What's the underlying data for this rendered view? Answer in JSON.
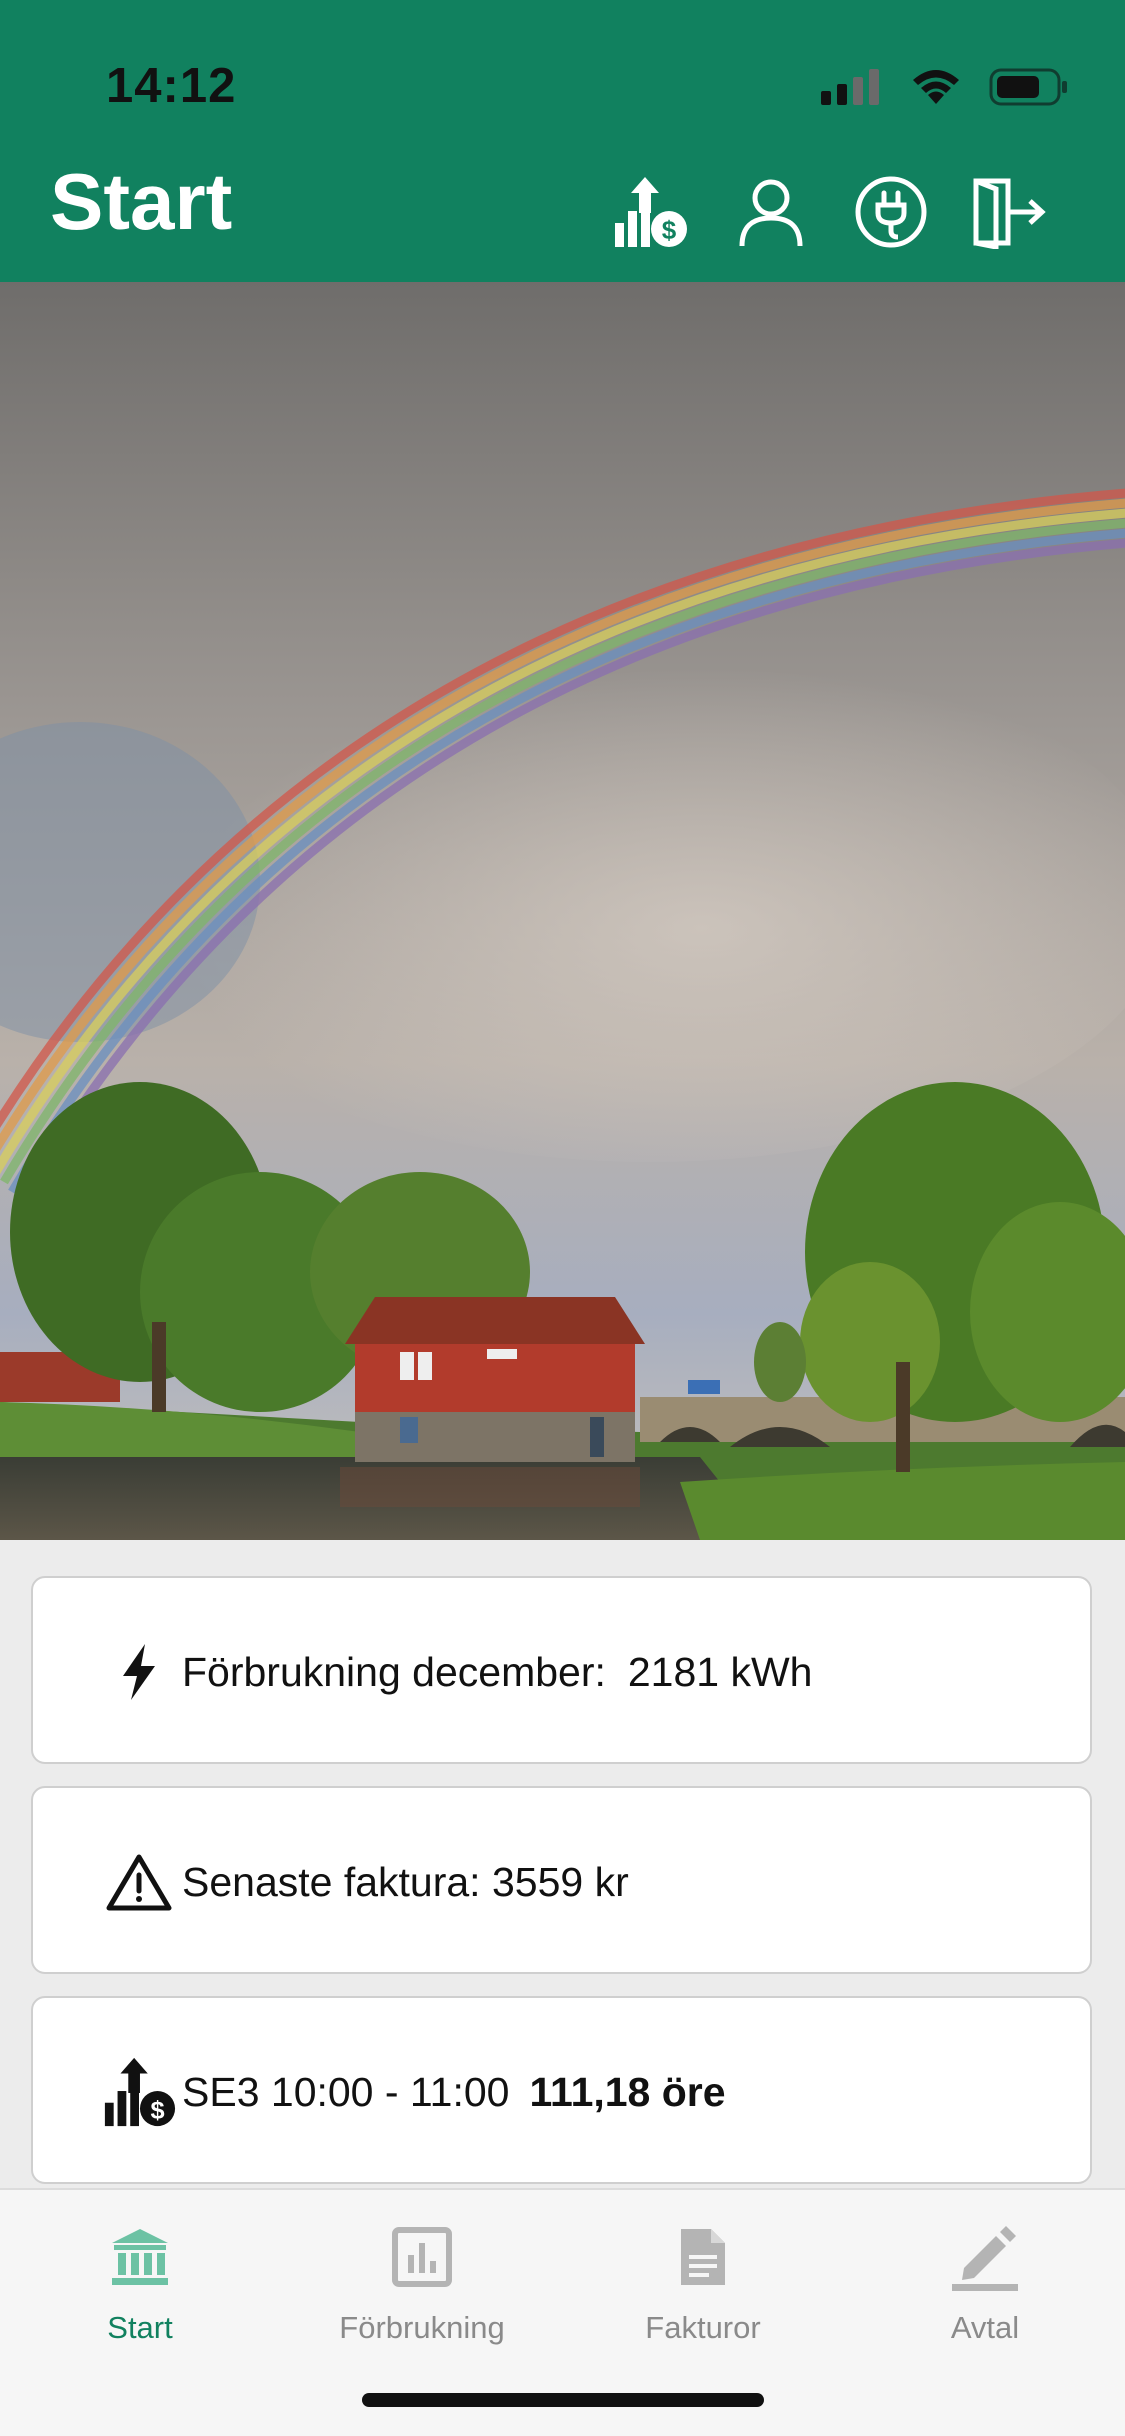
{
  "status_bar": {
    "time": "14:12"
  },
  "header": {
    "title": "Start",
    "icons": [
      "price-chart-icon",
      "user-icon",
      "plug-icon",
      "logout-icon"
    ],
    "background": "#11815f"
  },
  "cards": [
    {
      "icon": "lightning-icon",
      "label": "Förbrukning december:",
      "value": "2181 kWh"
    },
    {
      "icon": "warning-triangle-icon",
      "label": "Senaste faktura: 3559 kr"
    },
    {
      "icon": "price-chart-icon",
      "label": "SE3 10:00 - 11:00",
      "value": "111,18 öre"
    }
  ],
  "tabbar": {
    "active_color": "#11815f",
    "tabs": [
      {
        "label": "Start",
        "icon": "bank-icon",
        "active": true
      },
      {
        "label": "Förbrukning",
        "icon": "bar-chart-icon",
        "active": false
      },
      {
        "label": "Fakturor",
        "icon": "document-icon",
        "active": false
      },
      {
        "label": "Avtal",
        "icon": "pencil-icon",
        "active": false
      }
    ]
  }
}
